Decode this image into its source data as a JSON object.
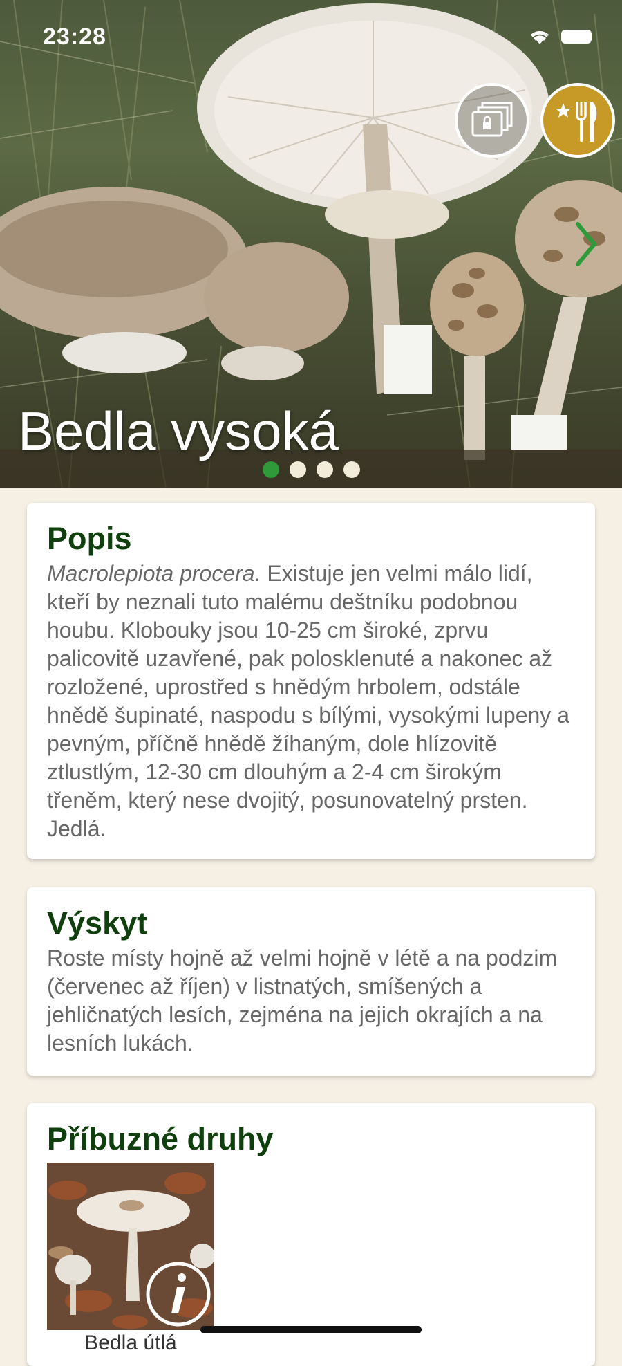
{
  "status_bar": {
    "time": "23:28"
  },
  "hero": {
    "title": "Bedla vysoká",
    "pages": 4,
    "active_page": 1,
    "buttons": {
      "gallery_icon": "gallery-lock-icon",
      "edible_icon": "star-cutlery-icon",
      "next_icon": "chevron-right-icon"
    },
    "colors": {
      "edible": "#c79a28",
      "active_dot": "#2f9a3a"
    }
  },
  "sections": {
    "popis": {
      "title": "Popis",
      "latin": "Macrolepiota procera.",
      "text": " Existuje jen velmi málo lidí, kteří by neznali tuto malému deštníku podobnou houbu. Klobouky jsou 10-25 cm široké, zprvu palicovitě uzavřené, pak polosklenuté a nakonec až rozložené, uprostřed s hnědým hrbolem, odstále hnědě šupinaté, naspodu s bílými, vysokými lupeny a pevným, příčně hnědě žíhaným, dole hlízovitě ztlustlým, 12-30 cm dlouhým a 2-4 cm širokým třeněm, který nese dvojitý, posunovatelný prsten. Jedlá."
    },
    "vyskyt": {
      "title": "Výskyt",
      "text": "Roste místy hojně až velmi hojně v létě a na podzim (červenec až říjen) v listnatých, smíšených a jehličnatých lesích, zejména na jejich okrajích a na lesních lukách."
    },
    "pribuzne": {
      "title": "Příbuzné druhy",
      "items": [
        {
          "label": "Bedla útlá",
          "icon": "info-icon"
        }
      ]
    }
  },
  "colors": {
    "background": "#f5efe4",
    "heading": "#0f3f0c",
    "body_text": "#676767"
  }
}
